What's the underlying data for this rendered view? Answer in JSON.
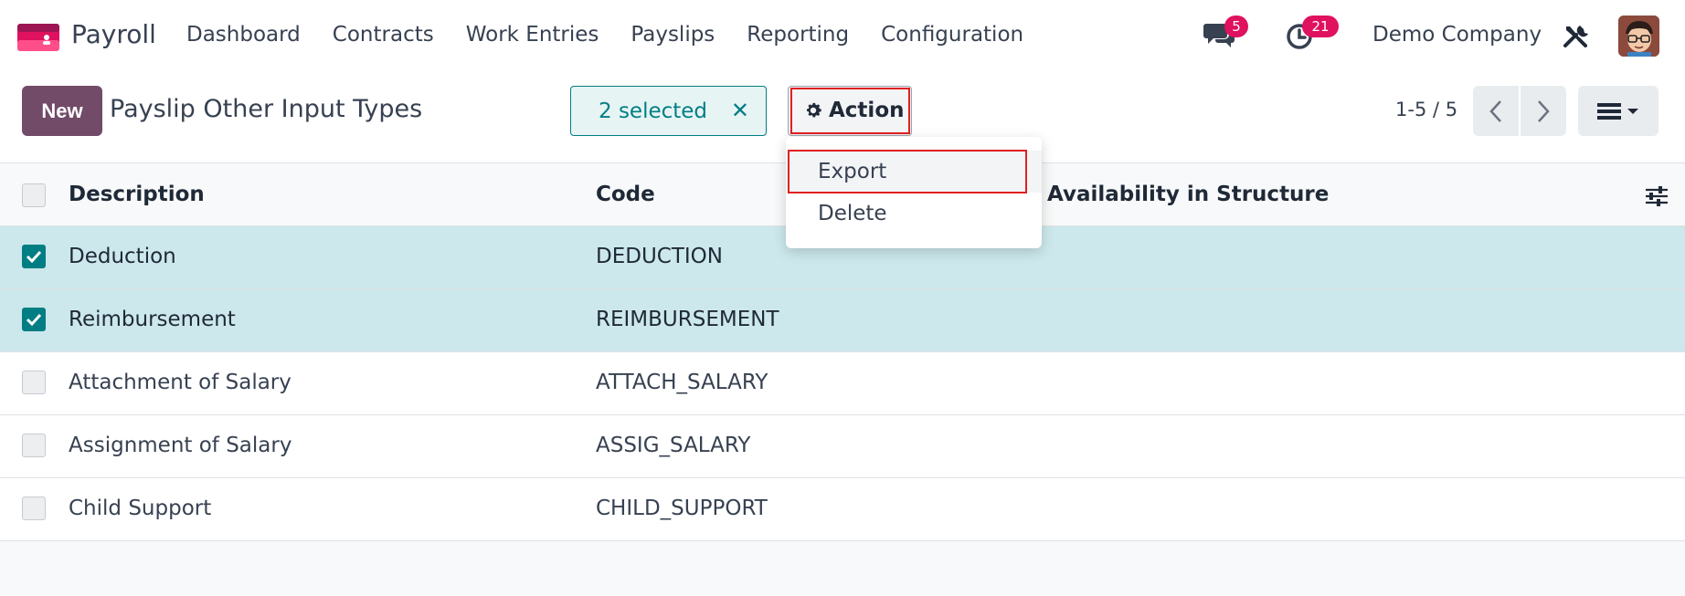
{
  "navbar": {
    "app_name": "Payroll",
    "menu": [
      "Dashboard",
      "Contracts",
      "Work Entries",
      "Payslips",
      "Reporting",
      "Configuration"
    ],
    "chat_count": "5",
    "activity_count": "21",
    "company": "Demo Company",
    "icons": [
      "app-logo-icon",
      "chat-icon",
      "clock-icon",
      "tools-icon",
      "avatar"
    ]
  },
  "control_panel": {
    "new_label": "New",
    "title": "Payslip Other Input Types",
    "selected_label": "2 selected",
    "close_glyph": "✕",
    "action_label": "Action",
    "pager": "1-5 / 5"
  },
  "action_menu": {
    "items": [
      "Export",
      "Delete"
    ]
  },
  "table": {
    "columns": [
      "Description",
      "Code",
      "Availability in Structure"
    ],
    "rows": [
      {
        "description": "Deduction",
        "code": "DEDUCTION",
        "selected": true
      },
      {
        "description": "Reimbursement",
        "code": "REIMBURSEMENT",
        "selected": true
      },
      {
        "description": "Attachment of Salary",
        "code": "ATTACH_SALARY",
        "selected": false
      },
      {
        "description": "Assignment of Salary",
        "code": "ASSIG_SALARY",
        "selected": false
      },
      {
        "description": "Child Support",
        "code": "CHILD_SUPPORT",
        "selected": false
      }
    ]
  },
  "colors": {
    "brand": "#714b67",
    "accent": "#017e84",
    "badge": "#e0115f",
    "highlight": "#e02020",
    "selected_row": "#cce8ec"
  }
}
